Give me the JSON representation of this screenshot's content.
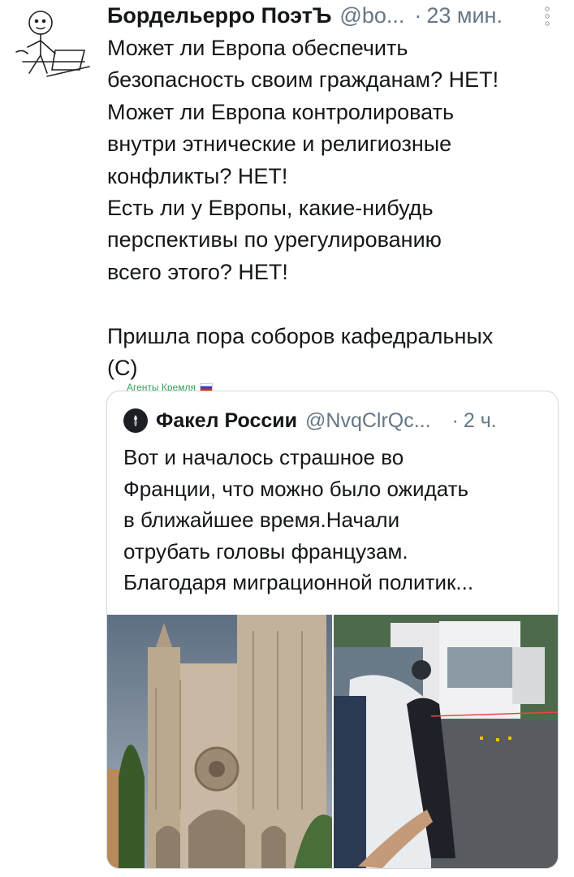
{
  "tweet": {
    "author_name": "Бордельерро ПоэтЪ",
    "author_handle": "@bo...",
    "separator": "·",
    "time": "23 мин.",
    "text": "Может ли Европа обеспечить\nбезопасность своим гражданам? НЕТ!\nМожет ли Европа контролировать\nвнутри этнические и религиозные\nконфликты? НЕТ!\nЕсть ли у Европы, какие-нибудь\nперспективы по урегулированию\nвсего этого? НЕТ!\n\nПришла пора соборов кафедральных\n(С)"
  },
  "stamp": {
    "label": "Агенты Кремля"
  },
  "quoted": {
    "author_name": "Факел России",
    "author_handle": "@NvqClrQc...",
    "separator": "·",
    "time": "2 ч.",
    "text": "Вот и началось страшное во\nФранции, что можно было ожидать\nв ближайшее время.Начали\nотрубать головы французам.\nБлагодаря миграционной политик..."
  },
  "icons": {
    "more": "more-vertical-icon",
    "avatar": "stick-figure-avatar",
    "quoted_avatar": "torch-logo-icon"
  },
  "colors": {
    "text": "#14171a",
    "secondary": "#657786",
    "border": "#cfd9de",
    "stamp": "#3aa05a"
  }
}
